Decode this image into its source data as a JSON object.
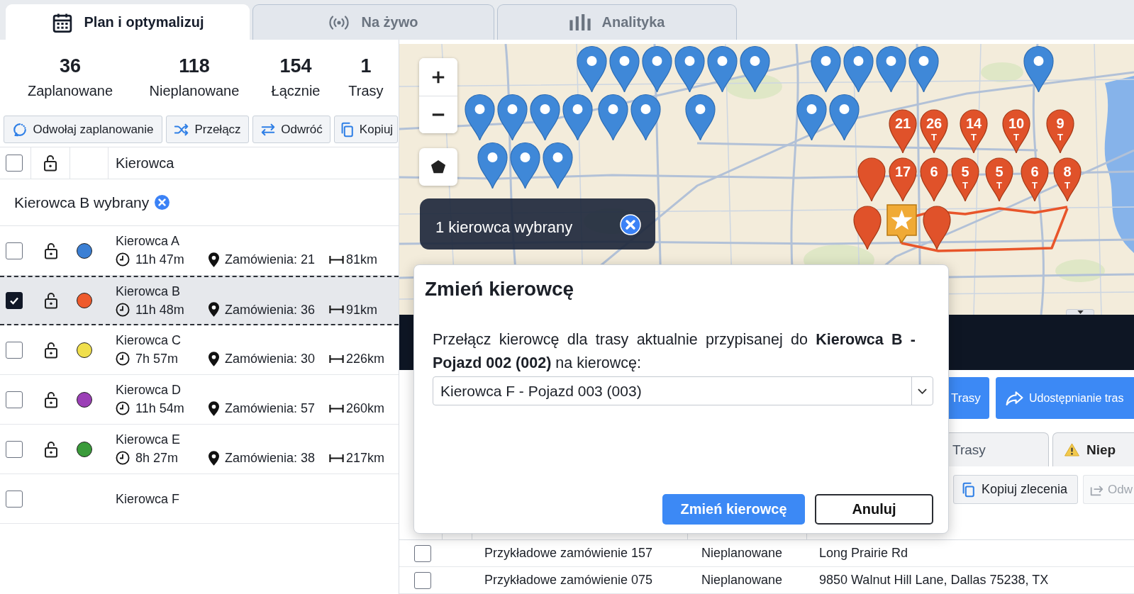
{
  "top_tabs": [
    {
      "label": "Plan i optymalizuj",
      "selected": true,
      "kind": "calendar"
    },
    {
      "label": "Na żywo",
      "selected": false,
      "kind": "live"
    },
    {
      "label": "Analityka",
      "selected": false,
      "kind": "analytics"
    }
  ],
  "summary": [
    {
      "value": "36",
      "label": "Zaplanowane"
    },
    {
      "value": "118",
      "label": "Nieplanowane"
    },
    {
      "value": "154",
      "label": "Łącznie"
    },
    {
      "value": "1",
      "label": "Trasy"
    }
  ],
  "driver_actions": [
    {
      "label": "Odwołaj zaplanowanie",
      "kind": "unschedule"
    },
    {
      "label": "Przełącz",
      "kind": "shuffle"
    },
    {
      "label": "Odwróć",
      "kind": "reverse"
    },
    {
      "label": "Kopiuj",
      "kind": "copy"
    }
  ],
  "driver_table": {
    "header_checked": false,
    "column_label": "Kierowca",
    "selection_text": "Kierowca B wybrany",
    "drivers": [
      {
        "name": "Kierowca A",
        "selected": false,
        "locked": false,
        "color": "#3b7fd4",
        "duration": "11h 47m",
        "orders": "Zamówienia: 21",
        "distance": "81km"
      },
      {
        "name": "Kierowca B",
        "selected": true,
        "locked": false,
        "color": "#ee5a2c",
        "duration": "11h 48m",
        "orders": "Zamówienia: 36",
        "distance": "91km"
      },
      {
        "name": "Kierowca C",
        "selected": false,
        "locked": false,
        "color": "#f0df4c",
        "duration": "7h 57m",
        "orders": "Zamówienia: 30",
        "distance": "226km"
      },
      {
        "name": "Kierowca D",
        "selected": false,
        "locked": false,
        "color": "#9b3fb6",
        "duration": "11h 54m",
        "orders": "Zamówienia: 57",
        "distance": "260km"
      },
      {
        "name": "Kierowca E",
        "selected": false,
        "locked": false,
        "color": "#3a9b3a",
        "duration": "8h 27m",
        "orders": "Zamówienia: 38",
        "distance": "217km"
      },
      {
        "name": "Kierowca F",
        "selected": false
      }
    ]
  },
  "map": {
    "selection_text": "1 kierowca wybrany",
    "route_markers": [
      {
        "number": "21"
      },
      {
        "number": "26",
        "sub": "T"
      },
      {
        "number": "14",
        "sub": "T"
      },
      {
        "number": "10",
        "sub": "T"
      },
      {
        "number": "9",
        "sub": "T"
      },
      {
        "number": "17"
      },
      {
        "number": "6"
      },
      {
        "number": "5",
        "sub": "T"
      },
      {
        "number": "5",
        "sub": "T"
      },
      {
        "number": "6",
        "sub": "T"
      },
      {
        "number": "8",
        "sub": "T"
      }
    ]
  },
  "route_actions": [
    {
      "label": "Trasy",
      "kind": "plain"
    },
    {
      "label": "Udostępnianie tras",
      "kind": "share"
    }
  ],
  "panel_tabs": [
    {
      "label": "Trasy",
      "selected": false,
      "kind": "plain"
    },
    {
      "label": "Niep",
      "selected": false,
      "kind": "warning"
    }
  ],
  "order_actions": [
    {
      "label": "Kopiuj zlecenia",
      "kind": "copy",
      "disabled": false
    },
    {
      "label": "Odw",
      "kind": "forward",
      "disabled": true
    }
  ],
  "orders": [
    {
      "checked": false,
      "name": "Przykładowe zamówienie 157",
      "status": "Nieplanowane",
      "address": "Long Prairie Rd"
    },
    {
      "checked": false,
      "name": "Przykładowe zamówienie 075",
      "status": "Nieplanowane",
      "address": "9850 Walnut Hill Lane, Dallas 75238, TX"
    }
  ],
  "dialog": {
    "title": "Zmień kierowcę",
    "message": "Przełącz kierowcę dla trasy aktualnie przypisanej do **Kierowca B - Pojazd 002 (002)** na kierowcę:",
    "select_value": "Kierowca F - Pojazd 003 (003)",
    "buttons": [
      {
        "label": "Zmień kierowcę",
        "kind": "primary"
      },
      {
        "label": "Anuluj",
        "kind": "secondary"
      }
    ]
  }
}
